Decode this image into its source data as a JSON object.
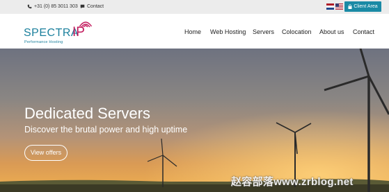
{
  "topbar": {
    "phone": "+31 (0) 85 3011 303",
    "contact": "Contact",
    "phone_icon": "phone-icon",
    "contact_icon": "chat-icon",
    "client_area": "Client Area",
    "client_area_icon": "lock-icon",
    "languages": [
      "nl-flag-icon",
      "us-flag-icon"
    ]
  },
  "logo": {
    "word": "SPECTRA",
    "ip": "IP",
    "tagline": "Performance Hosting"
  },
  "nav": {
    "items": [
      "Home",
      "Web Hosting",
      "Servers",
      "Colocation",
      "About us",
      "Contact"
    ]
  },
  "hero": {
    "title": "Dedicated Servers",
    "subtitle": "Discover the brutal power and high uptime",
    "button": "View offers"
  },
  "watermark": "赵容部落www.zrblog.net",
  "colors": {
    "accent": "#1a8aa5",
    "logo_teal": "#1a7f9c",
    "logo_magenta": "#c2185b"
  }
}
